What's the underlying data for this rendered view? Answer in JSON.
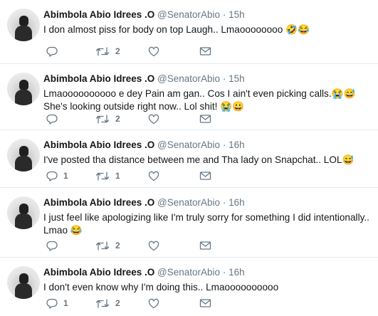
{
  "tweets": [
    {
      "name": "Abimbola Abio Idrees .O",
      "handle": "@SenatorAbio",
      "dot": "·",
      "time": "15h",
      "text": "I don almost piss for body on top Laugh.. Lmaoooooooo 🤣😂",
      "replies": "",
      "retweets": "2",
      "likes": ""
    },
    {
      "name": "Abimbola Abio Idrees .O",
      "handle": "@SenatorAbio",
      "dot": "·",
      "time": "15h",
      "text": "Lmaoooooooooo e dey Pain am gan.. Cos I ain't even picking calls.😭😅 She's looking outside right now.. Lol shit! 😭😀",
      "replies": "",
      "retweets": "2",
      "likes": ""
    },
    {
      "name": "Abimbola Abio Idrees .O",
      "handle": "@SenatorAbio",
      "dot": "·",
      "time": "16h",
      "text": "I've posted tha distance between me and Tha lady on Snapchat.. LOL😅",
      "replies": "1",
      "retweets": "1",
      "likes": ""
    },
    {
      "name": "Abimbola Abio Idrees .O",
      "handle": "@SenatorAbio",
      "dot": "·",
      "time": "16h",
      "text": "I just feel like apologizing like I'm truly sorry for something I did intentionally.. Lmao 😂",
      "replies": "",
      "retweets": "2",
      "likes": ""
    },
    {
      "name": "Abimbola Abio Idrees .O",
      "handle": "@SenatorAbio",
      "dot": "·",
      "time": "16h",
      "text": "I don't even know why I'm doing this.. Lmaoooooooooo",
      "replies": "1",
      "retweets": "2",
      "likes": ""
    }
  ],
  "icons": {
    "reply": "reply-icon",
    "retweet": "retweet-icon",
    "like": "heart-icon",
    "dm": "envelope-icon"
  },
  "colors": {
    "icon": "#657786",
    "divider": "#e6ecf0",
    "text": "#14171a"
  }
}
